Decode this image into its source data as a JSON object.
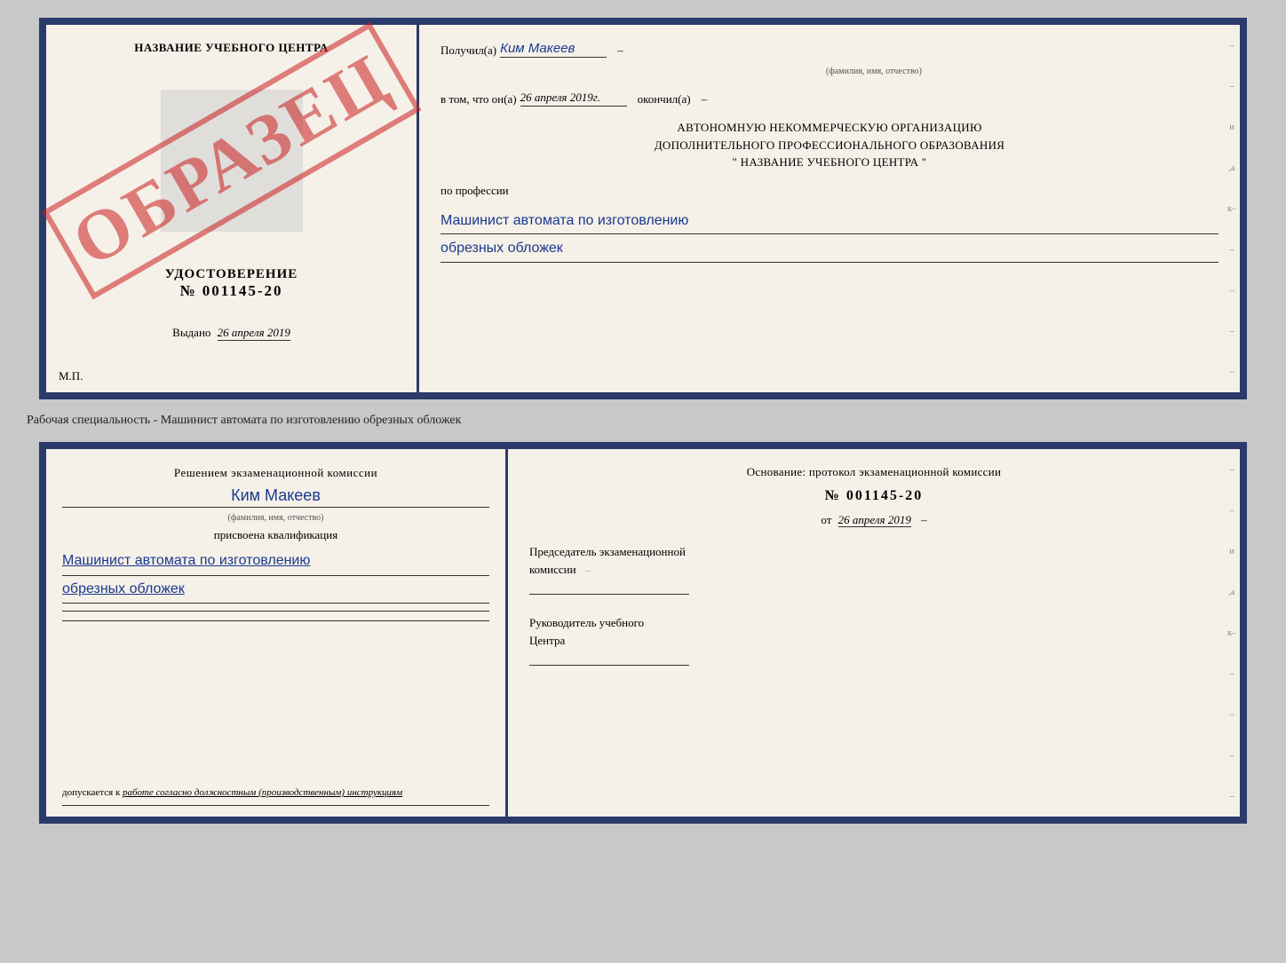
{
  "top_doc": {
    "left": {
      "school_name": "НАЗВАНИЕ УЧЕБНОГО ЦЕНТРА",
      "watermark": "ОБРАЗЕЦ",
      "udostoverenie_title": "УДОСТОВЕРЕНИЕ",
      "udostoverenie_num": "№ 001145-20",
      "vydano_prefix": "Выдано",
      "vydano_date": "26 апреля 2019",
      "mp": "М.П."
    },
    "right": {
      "poluchil_label": "Получил(а)",
      "poluchil_name": "Ким Макеев",
      "fio_sublabel": "(фамилия, имя, отчество)",
      "vtom_label": "в том, что он(а)",
      "vtom_date": "26 апреля 2019г.",
      "okonchill": "окончил(а)",
      "org_line1": "АВТОНОМНУЮ НЕКОММЕРЧЕСКУЮ ОРГАНИЗАЦИЮ",
      "org_line2": "ДОПОЛНИТЕЛЬНОГО ПРОФЕССИОНАЛЬНОГО ОБРАЗОВАНИЯ",
      "org_line3": "\"  НАЗВАНИЕ УЧЕБНОГО ЦЕНТРА  \"",
      "po_professii": "по профессии",
      "profession_line1": "Машинист автомата по изготовлению",
      "profession_line2": "обрезных обложек"
    }
  },
  "specialty_label": "Рабочая специальность - Машинист автомата по изготовлению обрезных обложек",
  "bottom_doc": {
    "left": {
      "resheniem_text": "Решением экзаменационной комиссии",
      "name_handwritten": "Ким Макеев",
      "fio_sublabel": "(фамилия, имя, отчество)",
      "prisvoena": "присвоена квалификация",
      "qualification_line1": "Машинист автомата по изготовлению",
      "qualification_line2": "обрезных обложек",
      "dopusk_prefix": "допускается к",
      "dopusk_text": "работе согласно должностным (производственным) инструкциям"
    },
    "right": {
      "osnovaniye": "Основание: протокол экзаменационной комиссии",
      "protocol_num": "№ 001145-20",
      "ot_prefix": "от",
      "ot_date": "26 апреля 2019",
      "predsedatel_line1": "Председатель экзаменационной",
      "predsedatel_line2": "комиссии",
      "rukovoditel_line1": "Руководитель учебного",
      "rukovoditel_line2": "Центра"
    }
  }
}
